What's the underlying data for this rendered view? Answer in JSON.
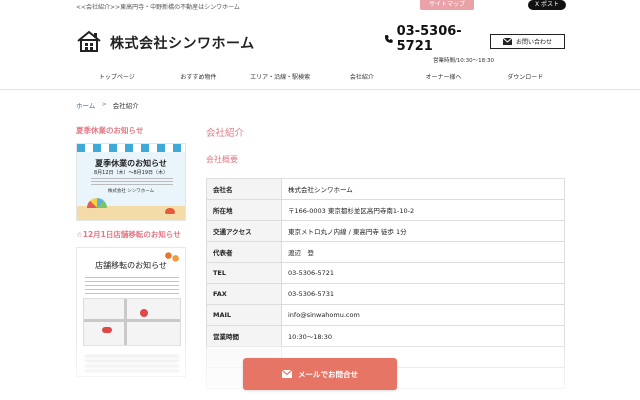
{
  "topbar": {
    "tagline": "<<会社紹介>>東高円寺・中野新橋の不動産はシンワホーム",
    "sitemap": "サイトマップ",
    "xpost": "X ポスト"
  },
  "header": {
    "company": "株式会社シンワホーム",
    "phone": "03-5306-5721",
    "hours": "営業時間/10:30〜18:30",
    "contact": "お問い合わせ"
  },
  "nav": {
    "items": [
      "トップページ",
      "おすすめ物件",
      "エリア・沿線・駅検索",
      "会社紹介",
      "オーナー様へ",
      "ダウンロード"
    ]
  },
  "breadcrumb": {
    "home": "ホーム",
    "sep": ">",
    "current": "会社紹介"
  },
  "sidebar": {
    "heading1": "夏季休業のお知らせ",
    "banner1": {
      "title": "夏季休業のお知らせ",
      "date": "8月12日（木）〜8月19日（木）",
      "company": "株式会社 シンワホーム"
    },
    "heading2": "☆12月1日店舗移転のお知らせ",
    "banner2": {
      "title": "店舗移転のお知らせ"
    }
  },
  "main": {
    "title": "会社紹介",
    "subtitle": "会社概要",
    "rows": [
      {
        "label": "会社名",
        "value": "株式会社シンワホーム"
      },
      {
        "label": "所在地",
        "value": "〒166-0003 東京都杉並区高円寺南1-10-2"
      },
      {
        "label": "交通アクセス",
        "value": "東京メトロ丸ノ内線 / 東高円寺 徒歩 1分"
      },
      {
        "label": "代表者",
        "value": "渡辺　登"
      },
      {
        "label": "TEL",
        "value": "03-5306-5721"
      },
      {
        "label": "FAX",
        "value": "03-5306-5731"
      },
      {
        "label": "MAIL",
        "value": "info@sinwahomu.com"
      },
      {
        "label": "営業時間",
        "value": "10:30〜18:30"
      }
    ]
  },
  "mail_button": {
    "label": "メールでお問合せ"
  },
  "colors": {
    "accent": "#e27a86",
    "button": "#e77565",
    "link": "#3a6ea5"
  }
}
